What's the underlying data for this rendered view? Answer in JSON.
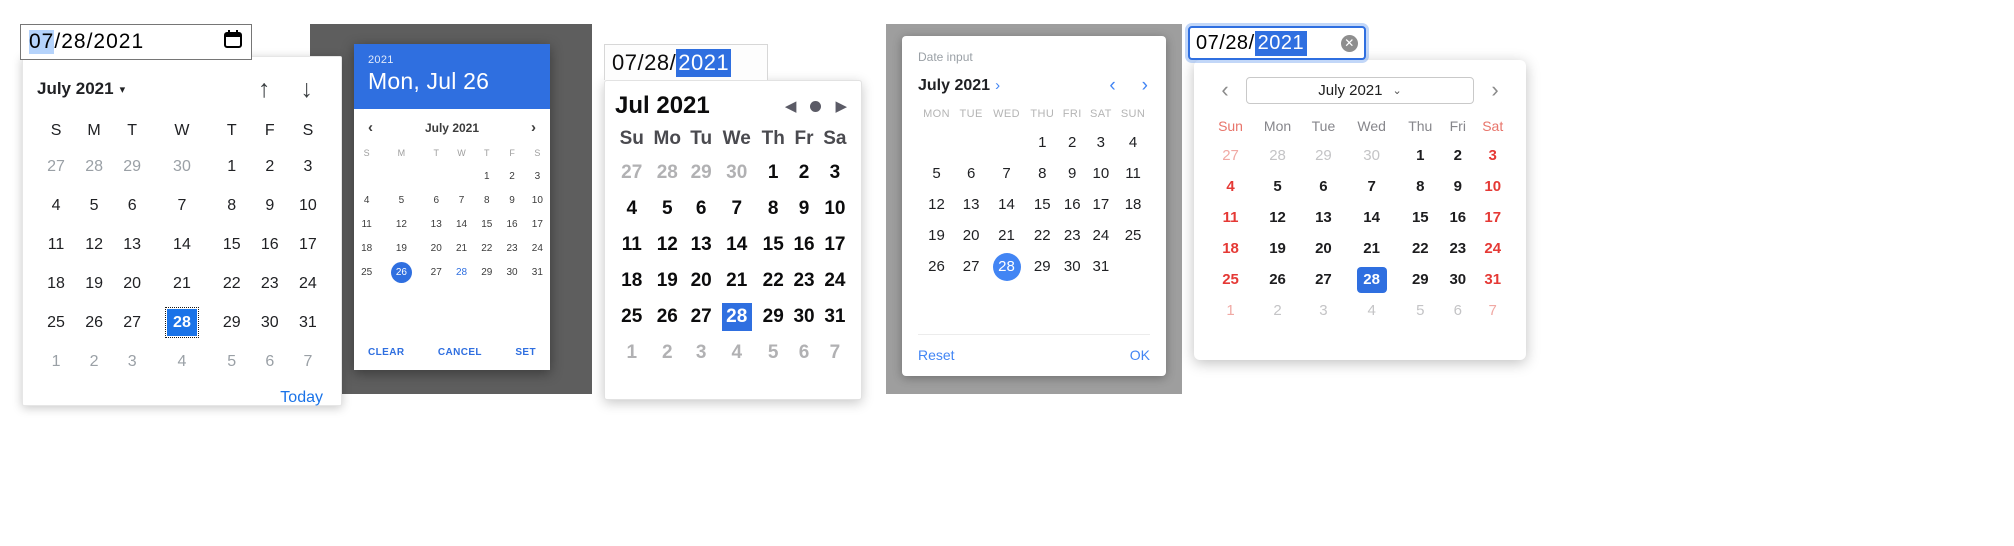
{
  "picker1": {
    "name": "chrome-date-picker",
    "input": {
      "month": "07",
      "day": "28",
      "year": "2021",
      "sep": "/",
      "icon": "calendar-icon"
    },
    "title": "July 2021",
    "caret": "▾",
    "prev_icon": "↑",
    "next_icon": "↓",
    "weekdays": [
      "S",
      "M",
      "T",
      "W",
      "T",
      "F",
      "S"
    ],
    "weeks": [
      [
        "27",
        "28",
        "29",
        "30",
        "1",
        "2",
        "3"
      ],
      [
        "4",
        "5",
        "6",
        "7",
        "8",
        "9",
        "10"
      ],
      [
        "11",
        "12",
        "13",
        "14",
        "15",
        "16",
        "17"
      ],
      [
        "18",
        "19",
        "20",
        "21",
        "22",
        "23",
        "24"
      ],
      [
        "25",
        "26",
        "27",
        "28",
        "29",
        "30",
        "31"
      ],
      [
        "1",
        "2",
        "3",
        "4",
        "5",
        "6",
        "7"
      ]
    ],
    "out_of_month": [
      "0-0",
      "0-1",
      "0-2",
      "0-3",
      "5-0",
      "5-1",
      "5-2",
      "5-3",
      "5-4",
      "5-5",
      "5-6"
    ],
    "selected": "4-3",
    "today_label": "Today",
    "accent": "#1a73e8"
  },
  "picker2": {
    "name": "material-date-dialog",
    "header_year": "2021",
    "header_date": "Mon, Jul 26",
    "title": "July 2021",
    "prev_icon": "‹",
    "next_icon": "›",
    "weekdays": [
      "S",
      "M",
      "T",
      "W",
      "T",
      "F",
      "S"
    ],
    "weeks": [
      [
        "",
        "",
        "",
        "",
        "1",
        "2",
        "3"
      ],
      [
        "4",
        "5",
        "6",
        "7",
        "8",
        "9",
        "10"
      ],
      [
        "11",
        "12",
        "13",
        "14",
        "15",
        "16",
        "17"
      ],
      [
        "18",
        "19",
        "20",
        "21",
        "22",
        "23",
        "24"
      ],
      [
        "25",
        "26",
        "27",
        "28",
        "29",
        "30",
        "31"
      ]
    ],
    "selected": "4-1",
    "today": "4-3",
    "clear_label": "CLEAR",
    "cancel_label": "CANCEL",
    "set_label": "SET",
    "accent": "#2f6fe0"
  },
  "picker3": {
    "name": "firefox-date-picker",
    "input": {
      "month": "07",
      "day": "28",
      "year": "2021",
      "sep": "/"
    },
    "title": "Jul 2021",
    "prev_icon": "◀",
    "next_icon": "▶",
    "weekdays": [
      "Su",
      "Mo",
      "Tu",
      "We",
      "Th",
      "Fr",
      "Sa"
    ],
    "weeks": [
      [
        "27",
        "28",
        "29",
        "30",
        "1",
        "2",
        "3"
      ],
      [
        "4",
        "5",
        "6",
        "7",
        "8",
        "9",
        "10"
      ],
      [
        "11",
        "12",
        "13",
        "14",
        "15",
        "16",
        "17"
      ],
      [
        "18",
        "19",
        "20",
        "21",
        "22",
        "23",
        "24"
      ],
      [
        "25",
        "26",
        "27",
        "28",
        "29",
        "30",
        "31"
      ],
      [
        "1",
        "2",
        "3",
        "4",
        "5",
        "6",
        "7"
      ]
    ],
    "out_of_month": [
      "0-0",
      "0-1",
      "0-2",
      "0-3",
      "5-0",
      "5-1",
      "5-2",
      "5-3",
      "5-4",
      "5-5",
      "5-6"
    ],
    "selected": "4-3",
    "accent": "#2f6fe0"
  },
  "picker4": {
    "name": "edge-date-input-sheet",
    "label": "Date input",
    "title": "July 2021",
    "title_chevron": "›",
    "prev_icon": "‹",
    "next_icon": "›",
    "weekdays": [
      "MON",
      "TUE",
      "WED",
      "THU",
      "FRI",
      "SAT",
      "SUN"
    ],
    "weeks": [
      [
        "",
        "",
        "",
        "1",
        "2",
        "3",
        "4"
      ],
      [
        "5",
        "6",
        "7",
        "8",
        "9",
        "10",
        "11"
      ],
      [
        "12",
        "13",
        "14",
        "15",
        "16",
        "17",
        "18"
      ],
      [
        "19",
        "20",
        "21",
        "22",
        "23",
        "24",
        "25"
      ],
      [
        "26",
        "27",
        "28",
        "29",
        "30",
        "31",
        ""
      ]
    ],
    "selected": "4-2",
    "reset_label": "Reset",
    "ok_label": "OK",
    "accent": "#4285f4"
  },
  "picker5": {
    "name": "safari-date-picker",
    "input": {
      "month": "07",
      "day": "28",
      "year": "2021",
      "sep": "/",
      "clear_icon": "clear-circle-icon"
    },
    "month_select": "July 2021",
    "select_caret": "⌄",
    "prev_icon": "‹",
    "next_icon": "›",
    "weekdays": [
      "Sun",
      "Mon",
      "Tue",
      "Wed",
      "Thu",
      "Fri",
      "Sat"
    ],
    "weekend_cols": [
      0,
      6
    ],
    "weeks": [
      [
        "27",
        "28",
        "29",
        "30",
        "1",
        "2",
        "3"
      ],
      [
        "4",
        "5",
        "6",
        "7",
        "8",
        "9",
        "10"
      ],
      [
        "11",
        "12",
        "13",
        "14",
        "15",
        "16",
        "17"
      ],
      [
        "18",
        "19",
        "20",
        "21",
        "22",
        "23",
        "24"
      ],
      [
        "25",
        "26",
        "27",
        "28",
        "29",
        "30",
        "31"
      ],
      [
        "1",
        "2",
        "3",
        "4",
        "5",
        "6",
        "7"
      ]
    ],
    "out_of_month": [
      "0-0",
      "0-1",
      "0-2",
      "0-3",
      "5-0",
      "5-1",
      "5-2",
      "5-3",
      "5-4",
      "5-5",
      "5-6"
    ],
    "selected": "4-3",
    "accent": "#2f6fe0",
    "weekend_color": "#e53935"
  }
}
